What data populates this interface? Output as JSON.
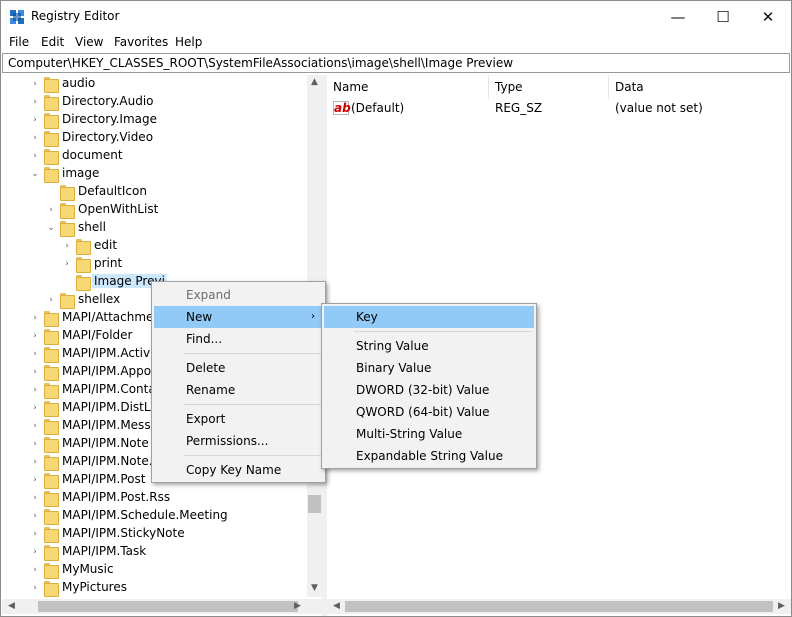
{
  "window": {
    "title": "Registry Editor",
    "controls": {
      "minimize": "—",
      "maximize": "☐",
      "close": "✕"
    }
  },
  "menubar": [
    "File",
    "Edit",
    "View",
    "Favorites",
    "Help"
  ],
  "address": "Computer\\HKEY_CLASSES_ROOT\\SystemFileAssociations\\image\\shell\\Image Preview",
  "tree": [
    {
      "label": "audio",
      "level": 0,
      "expander": "›"
    },
    {
      "label": "Directory.Audio",
      "level": 0,
      "expander": "›"
    },
    {
      "label": "Directory.Image",
      "level": 0,
      "expander": "›"
    },
    {
      "label": "Directory.Video",
      "level": 0,
      "expander": "›"
    },
    {
      "label": "document",
      "level": 0,
      "expander": "›"
    },
    {
      "label": "image",
      "level": 0,
      "expander": "⌄"
    },
    {
      "label": "DefaultIcon",
      "level": 1,
      "expander": ""
    },
    {
      "label": "OpenWithList",
      "level": 1,
      "expander": "›"
    },
    {
      "label": "shell",
      "level": 1,
      "expander": "⌄"
    },
    {
      "label": "edit",
      "level": 2,
      "expander": "›"
    },
    {
      "label": "print",
      "level": 2,
      "expander": "›"
    },
    {
      "label": "Image Previ",
      "level": 2,
      "expander": "",
      "selected": true
    },
    {
      "label": "shellex",
      "level": 1,
      "expander": "›"
    },
    {
      "label": "MAPI/Attachmen",
      "level": 0,
      "expander": "›"
    },
    {
      "label": "MAPI/Folder",
      "level": 0,
      "expander": "›"
    },
    {
      "label": "MAPI/IPM.Activi",
      "level": 0,
      "expander": "›"
    },
    {
      "label": "MAPI/IPM.Appo",
      "level": 0,
      "expander": "›"
    },
    {
      "label": "MAPI/IPM.Conta",
      "level": 0,
      "expander": "›"
    },
    {
      "label": "MAPI/IPM.DistLi",
      "level": 0,
      "expander": "›"
    },
    {
      "label": "MAPI/IPM.Messa",
      "level": 0,
      "expander": "›"
    },
    {
      "label": "MAPI/IPM.Note",
      "level": 0,
      "expander": "›"
    },
    {
      "label": "MAPI/IPM.Note.",
      "level": 0,
      "expander": "›"
    },
    {
      "label": "MAPI/IPM.Post",
      "level": 0,
      "expander": "›"
    },
    {
      "label": "MAPI/IPM.Post.Rss",
      "level": 0,
      "expander": "›"
    },
    {
      "label": "MAPI/IPM.Schedule.Meeting",
      "level": 0,
      "expander": "›"
    },
    {
      "label": "MAPI/IPM.StickyNote",
      "level": 0,
      "expander": "›"
    },
    {
      "label": "MAPI/IPM.Task",
      "level": 0,
      "expander": "›"
    },
    {
      "label": "MyMusic",
      "level": 0,
      "expander": "›"
    },
    {
      "label": "MyPictures",
      "level": 0,
      "expander": "›"
    }
  ],
  "list": {
    "columns": [
      "Name",
      "Type",
      "Data"
    ],
    "rows": [
      {
        "icon": "ab",
        "name": "(Default)",
        "type": "REG_SZ",
        "data": "(value not set)"
      }
    ]
  },
  "context_menu": {
    "items": [
      {
        "label": "Expand",
        "disabled": true
      },
      {
        "label": "New",
        "submenu": true,
        "hover": true,
        "arrow": "›"
      },
      {
        "label": "Find..."
      },
      {
        "sep": true
      },
      {
        "label": "Delete"
      },
      {
        "label": "Rename"
      },
      {
        "sep": true
      },
      {
        "label": "Export"
      },
      {
        "label": "Permissions..."
      },
      {
        "sep": true
      },
      {
        "label": "Copy Key Name"
      }
    ]
  },
  "submenu": {
    "items": [
      {
        "label": "Key",
        "hover": true
      },
      {
        "sep": true
      },
      {
        "label": "String Value"
      },
      {
        "label": "Binary Value"
      },
      {
        "label": "DWORD (32-bit) Value"
      },
      {
        "label": "QWORD (64-bit) Value"
      },
      {
        "label": "Multi-String Value"
      },
      {
        "label": "Expandable String Value"
      }
    ]
  },
  "scrollbar_arrows": {
    "up": "▲",
    "down": "▼",
    "left": "◀",
    "right": "▶"
  }
}
